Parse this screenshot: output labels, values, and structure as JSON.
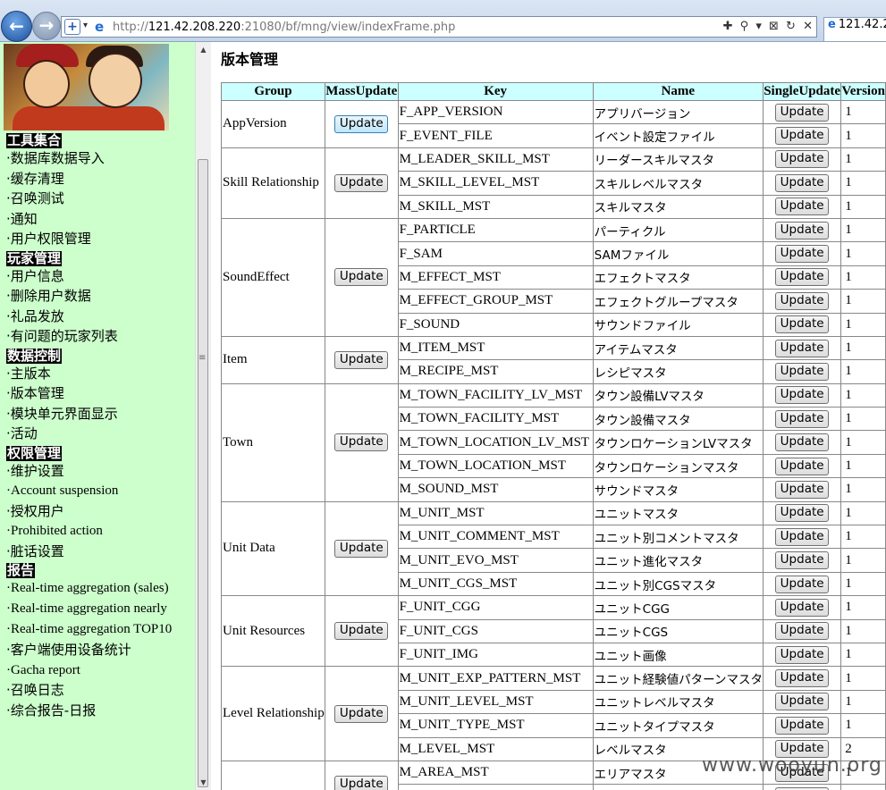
{
  "browser": {
    "url_prefix": "http://",
    "url_host": "121.42.208.220",
    "url_rest": ":21080/bf/mng/view/indexFrame.php",
    "tab_title": "121.42.2",
    "tools": [
      "✚",
      "⚲",
      "▾",
      "⊠",
      "↻",
      "✕"
    ]
  },
  "sidebar": {
    "sections": [
      {
        "title": "工具集合",
        "items": [
          {
            "label": "数据库数据导入"
          },
          {
            "label": "缓存清理"
          },
          {
            "label": "召唤测试"
          },
          {
            "label": "通知"
          },
          {
            "label": "用户权限管理"
          }
        ]
      },
      {
        "title": "玩家管理",
        "items": [
          {
            "label": "用户信息"
          },
          {
            "label": "删除用户数据"
          },
          {
            "label": "礼品发放"
          },
          {
            "label": "有问题的玩家列表"
          }
        ]
      },
      {
        "title": "数据控制",
        "items": [
          {
            "label": "主版本"
          },
          {
            "label": "版本管理"
          },
          {
            "label": "模块单元界面显示"
          },
          {
            "label": "活动"
          }
        ]
      },
      {
        "title": "权限管理",
        "items": [
          {
            "label": "维护设置"
          },
          {
            "label": "Account suspension",
            "en": true
          },
          {
            "label": "授权用户"
          },
          {
            "label": "Prohibited action",
            "en": true
          },
          {
            "label": "脏话设置"
          }
        ]
      },
      {
        "title": "报告",
        "items": [
          {
            "label": "Real-time aggregation (sales)",
            "en": true,
            "wrap": true
          },
          {
            "label": "Real-time aggregation nearly",
            "en": true,
            "wrap": true
          },
          {
            "label": "Real-time aggregation TOP10",
            "en": true,
            "wrap": true
          },
          {
            "label": "客户端使用设备统计"
          },
          {
            "label": "Gacha report",
            "en": true
          },
          {
            "label": "召唤日志"
          },
          {
            "label": "综合报告-日报"
          }
        ]
      }
    ]
  },
  "main": {
    "title": "版本管理",
    "columns": [
      "Group",
      "MassUpdate",
      "Key",
      "Name",
      "SingleUpdate",
      "Version"
    ],
    "button_label": "Update",
    "groups": [
      {
        "name": "AppVersion",
        "rows": [
          {
            "key": "F_APP_VERSION",
            "name": "アプリバージョン",
            "version": "1"
          },
          {
            "key": "F_EVENT_FILE",
            "name": "イベント設定ファイル",
            "version": "1"
          }
        ]
      },
      {
        "name": "Skill Relationship",
        "rows": [
          {
            "key": "M_LEADER_SKILL_MST",
            "name": "リーダースキルマスタ",
            "version": "1"
          },
          {
            "key": "M_SKILL_LEVEL_MST",
            "name": "スキルレベルマスタ",
            "version": "1"
          },
          {
            "key": "M_SKILL_MST",
            "name": "スキルマスタ",
            "version": "1"
          }
        ]
      },
      {
        "name": "SoundEffect",
        "rows": [
          {
            "key": "F_PARTICLE",
            "name": "パーティクル",
            "version": "1"
          },
          {
            "key": "F_SAM",
            "name": "SAMファイル",
            "version": "1"
          },
          {
            "key": "M_EFFECT_MST",
            "name": "エフェクトマスタ",
            "version": "1"
          },
          {
            "key": "M_EFFECT_GROUP_MST",
            "name": "エフェクトグループマスタ",
            "version": "1"
          },
          {
            "key": "F_SOUND",
            "name": "サウンドファイル",
            "version": "1"
          }
        ]
      },
      {
        "name": "Item",
        "rows": [
          {
            "key": "M_ITEM_MST",
            "name": "アイテムマスタ",
            "version": "1"
          },
          {
            "key": "M_RECIPE_MST",
            "name": "レシピマスタ",
            "version": "1"
          }
        ]
      },
      {
        "name": "Town",
        "rows": [
          {
            "key": "M_TOWN_FACILITY_LV_MST",
            "name": "タウン設備LVマスタ",
            "version": "1"
          },
          {
            "key": "M_TOWN_FACILITY_MST",
            "name": "タウン設備マスタ",
            "version": "1"
          },
          {
            "key": "M_TOWN_LOCATION_LV_MST",
            "name": "タウンロケーションLVマスタ",
            "version": "1"
          },
          {
            "key": "M_TOWN_LOCATION_MST",
            "name": "タウンロケーションマスタ",
            "version": "1"
          },
          {
            "key": "M_SOUND_MST",
            "name": "サウンドマスタ",
            "version": "1"
          }
        ]
      },
      {
        "name": "Unit Data",
        "rows": [
          {
            "key": "M_UNIT_MST",
            "name": "ユニットマスタ",
            "version": "1"
          },
          {
            "key": "M_UNIT_COMMENT_MST",
            "name": "ユニット別コメントマスタ",
            "version": "1"
          },
          {
            "key": "M_UNIT_EVO_MST",
            "name": "ユニット進化マスタ",
            "version": "1"
          },
          {
            "key": "M_UNIT_CGS_MST",
            "name": "ユニット別CGSマスタ",
            "version": "1"
          }
        ]
      },
      {
        "name": "Unit Resources",
        "rows": [
          {
            "key": "F_UNIT_CGG",
            "name": "ユニットCGG",
            "version": "1"
          },
          {
            "key": "F_UNIT_CGS",
            "name": "ユニットCGS",
            "version": "1"
          },
          {
            "key": "F_UNIT_IMG",
            "name": "ユニット画像",
            "version": "1"
          }
        ]
      },
      {
        "name": "Level Relationship",
        "rows": [
          {
            "key": "M_UNIT_EXP_PATTERN_MST",
            "name": "ユニット経験値パターンマスタ",
            "version": "1"
          },
          {
            "key": "M_UNIT_LEVEL_MST",
            "name": "ユニットレベルマスタ",
            "version": "1"
          },
          {
            "key": "M_UNIT_TYPE_MST",
            "name": "ユニットタイプマスタ",
            "version": "1"
          },
          {
            "key": "M_LEVEL_MST",
            "name": "レベルマスタ",
            "version": "2"
          }
        ]
      },
      {
        "name": "",
        "rows": [
          {
            "key": "M_AREA_MST",
            "name": "エリアマスタ",
            "version": "1"
          },
          {
            "key": "",
            "name": "",
            "version": ""
          }
        ]
      }
    ]
  },
  "watermark": "www.wooyun.org"
}
